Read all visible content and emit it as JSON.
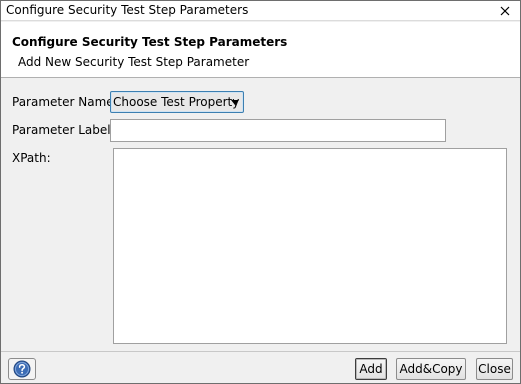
{
  "window": {
    "title": "Configure Security Test Step Parameters"
  },
  "header": {
    "title": "Configure Security Test Step Parameters",
    "subtitle": "Add New Security Test Step Parameter"
  },
  "form": {
    "parameter_name_label": "Parameter Name:",
    "parameter_name_value": "Choose Test Property",
    "parameter_label_label": "Parameter Label:",
    "parameter_label_value": "",
    "xpath_label": "XPath:",
    "xpath_value": ""
  },
  "footer": {
    "add_label": "Add",
    "add_copy_label": "Add&Copy",
    "close_label": "Close"
  },
  "icons": {
    "close": "close-icon",
    "help": "help-icon",
    "dropdown": "chevron-down-icon"
  }
}
